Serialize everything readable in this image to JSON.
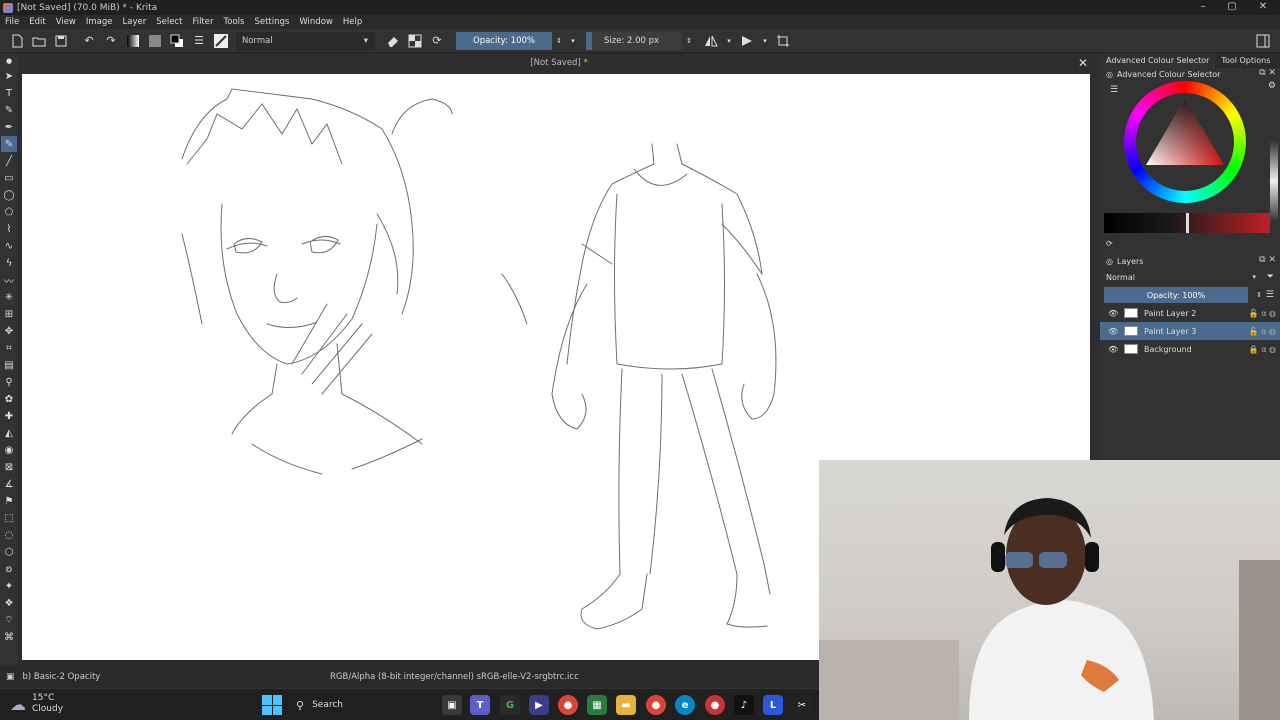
{
  "window": {
    "title": "[Not Saved]  (70.0 MiB)  * - Krita",
    "minimize": "–",
    "maximize": "▢",
    "close": "✕"
  },
  "menu": [
    "File",
    "Edit",
    "View",
    "Image",
    "Layer",
    "Select",
    "Filter",
    "Tools",
    "Settings",
    "Window",
    "Help"
  ],
  "toolbar": {
    "blend_mode": "Normal",
    "opacity": "Opacity: 100%",
    "size": "Size: 2.00 px"
  },
  "document": {
    "tab_title": "[Not Saved]  *",
    "close": "✕"
  },
  "dock": {
    "tabs": [
      "Advanced Colour Selector",
      "Tool Options"
    ],
    "colour_panel_title": "Advanced Colour Selector",
    "layers_title": "Layers",
    "layers_blend": "Normal",
    "layers_opacity": "Opacity:  100%",
    "layers": [
      {
        "name": "Paint Layer 2",
        "selected": false
      },
      {
        "name": "Paint Layer 3",
        "selected": true
      },
      {
        "name": "Background",
        "selected": false
      }
    ]
  },
  "status": {
    "brush": "b) Basic-2 Opacity",
    "colorspace": "RGB/Alpha (8-bit integer/channel)  sRGB-elle-V2-srgbtrc.icc"
  },
  "taskbar": {
    "weather_temp": "15°C",
    "weather_desc": "Cloudy",
    "search": "Search"
  },
  "colors": {
    "accent": "#4a6a8e",
    "panel": "#323232",
    "canvas": "#ffffff"
  }
}
